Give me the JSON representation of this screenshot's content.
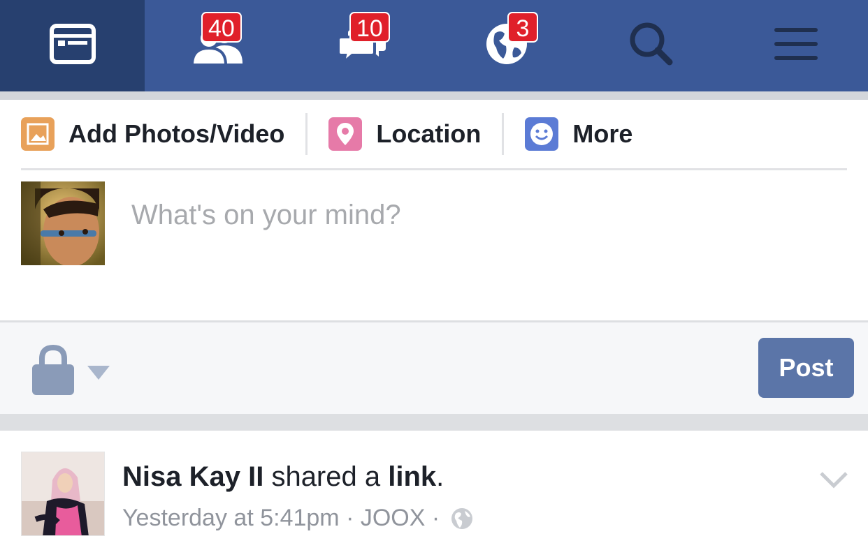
{
  "nav": {
    "tabs": [
      {
        "name": "news-feed",
        "badge": null
      },
      {
        "name": "friend-requests",
        "badge": "40"
      },
      {
        "name": "messages",
        "badge": "10"
      },
      {
        "name": "notifications",
        "badge": "3"
      },
      {
        "name": "search",
        "badge": null
      },
      {
        "name": "more",
        "badge": null
      }
    ]
  },
  "composer": {
    "actions": {
      "photos": "Add Photos/Video",
      "location": "Location",
      "more": "More"
    },
    "placeholder": "What's on your mind?"
  },
  "privacy": {
    "post_label": "Post"
  },
  "story": {
    "author": "Nisa Kay II",
    "verb": " shared a ",
    "object": "link",
    "end": ".",
    "time": "Yesterday at 5:41pm",
    "sep": " · ",
    "app": "JOOX",
    "sep2": " · "
  },
  "colors": {
    "brand": "#3b5998",
    "badge": "#e0202a",
    "post_button": "#5b75a8"
  }
}
